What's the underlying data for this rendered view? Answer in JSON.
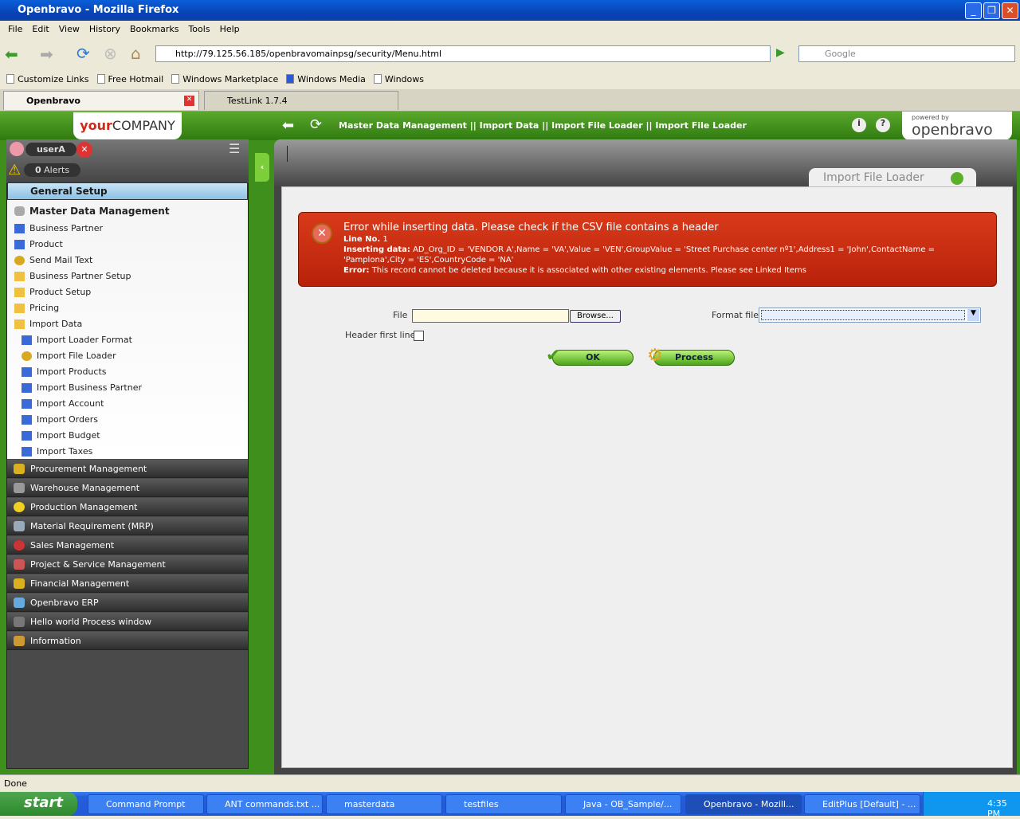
{
  "window": {
    "title": "Openbravo - Mozilla Firefox"
  },
  "menu": [
    "File",
    "Edit",
    "View",
    "History",
    "Bookmarks",
    "Tools",
    "Help"
  ],
  "url": "http://79.125.56.185/openbravomainpsg/security/Menu.html",
  "search_placeholder": "Google",
  "bookmarks": [
    "Customize Links",
    "Free Hotmail",
    "Windows Marketplace",
    "Windows Media",
    "Windows"
  ],
  "tabs": [
    "Openbravo",
    "TestLink 1.7.4"
  ],
  "app": {
    "logo": {
      "bold": "your",
      "rest": "COMPANY"
    },
    "breadcrumb": "Master Data Management || Import Data || Import File Loader  ||  Import File Loader",
    "powered_by": "powered by",
    "brand": "openbravo",
    "user": "userA",
    "alerts_count": "0",
    "alerts_label": "Alerts",
    "page_tab": "Import File Loader"
  },
  "sidebar": {
    "general": "General Setup",
    "master": "Master Data Management",
    "items": [
      "Business Partner",
      "Product",
      "Send Mail Text",
      "Business Partner Setup",
      "Product Setup",
      "Pricing",
      "Import Data"
    ],
    "subitems": [
      "Import Loader Format",
      "Import File Loader",
      "Import Products",
      "Import Business Partner",
      "Import Account",
      "Import Orders",
      "Import Budget",
      "Import Taxes"
    ],
    "sections": [
      "Procurement Management",
      "Warehouse Management",
      "Production Management",
      "Material Requirement (MRP)",
      "Sales Management",
      "Project & Service Management",
      "Financial Management",
      "Openbravo ERP",
      "Hello world Process window",
      "Information"
    ]
  },
  "error": {
    "title": "Error while inserting data. Please check if the CSV file contains a header",
    "line_label": "Line No.",
    "line_value": "1",
    "data_label": "Inserting data:",
    "data_value": "AD_Org_ID = 'VENDOR A',Name = 'VA',Value = 'VEN',GroupValue = 'Street Purchase center nº1',Address1 = 'John',ContactName = 'Pamplona',City = 'ES',CountryCode = 'NA'",
    "error_label": "Error:",
    "error_value": "This record cannot be deleted because it is associated with other existing elements. Please see Linked Items"
  },
  "form": {
    "file_label": "File",
    "file_value": "",
    "browse": "Browse...",
    "format_label": "Format file",
    "format_value": "",
    "header_label": "Header first line",
    "ok": "OK",
    "process": "Process"
  },
  "status": "Done",
  "taskbar": {
    "start": "start",
    "items": [
      "Command Prompt",
      "ANT commands.txt ...",
      "masterdata",
      "testfiles",
      "Java - OB_Sample/...",
      "Openbravo - Mozill...",
      "EditPlus [Default] - ..."
    ],
    "clock": "4:35 PM"
  }
}
